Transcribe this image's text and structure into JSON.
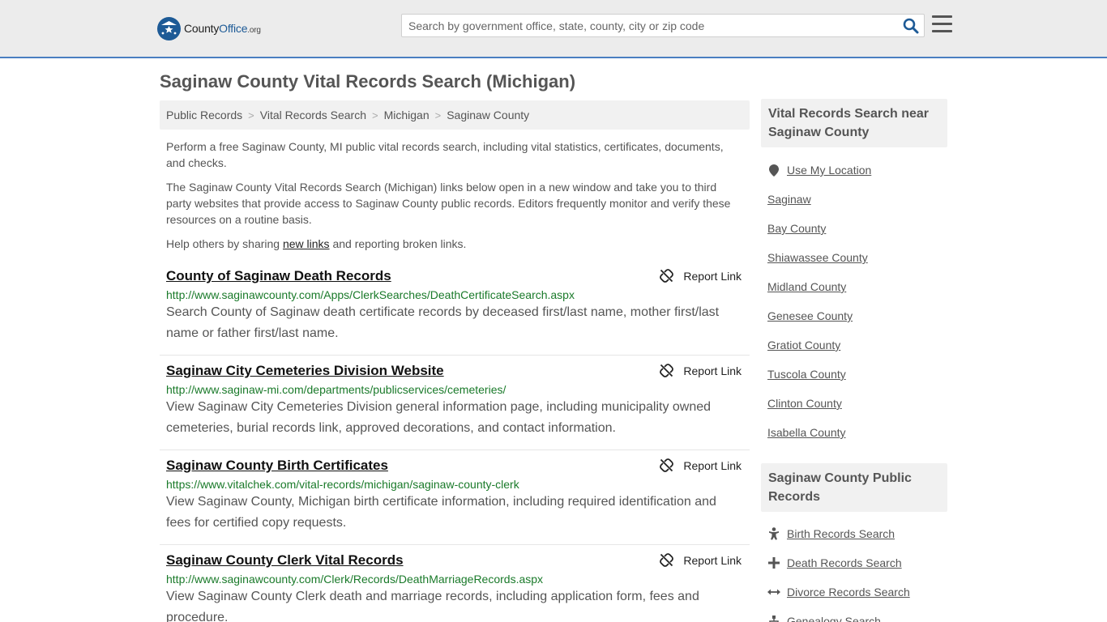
{
  "header": {
    "logo": {
      "county": "County",
      "office": "Office",
      "org": ".org"
    },
    "search_placeholder": "Search by government office, state, county, city or zip code"
  },
  "page_title": "Saginaw County Vital Records Search (Michigan)",
  "breadcrumb": [
    "Public Records",
    "Vital Records Search",
    "Michigan",
    "Saginaw County"
  ],
  "intro": {
    "p1": "Perform a free Saginaw County, MI public vital records search, including vital statistics, certificates, documents, and checks.",
    "p2": "The Saginaw County Vital Records Search (Michigan) links below open in a new window and take you to third party websites that provide access to Saginaw County public records. Editors frequently monitor and verify these resources on a routine basis.",
    "p3_before": "Help others by sharing ",
    "p3_link": "new links",
    "p3_after": " and reporting broken links."
  },
  "report_label": "Report Link",
  "results": [
    {
      "title": "County of Saginaw Death Records",
      "url": "http://www.saginawcounty.com/Apps/ClerkSearches/DeathCertificateSearch.aspx",
      "desc": "Search County of Saginaw death certificate records by deceased first/last name, mother first/last name or father first/last name."
    },
    {
      "title": "Saginaw City Cemeteries Division Website",
      "url": "http://www.saginaw-mi.com/departments/publicservices/cemeteries/",
      "desc": "View Saginaw City Cemeteries Division general information page, including municipality owned cemeteries, burial records link, approved decorations, and contact information."
    },
    {
      "title": "Saginaw County Birth Certificates",
      "url": "https://www.vitalchek.com/vital-records/michigan/saginaw-county-clerk",
      "desc": "View Saginaw County, Michigan birth certificate information, including required identification and fees for certified copy requests."
    },
    {
      "title": "Saginaw County Clerk Vital Records",
      "url": "http://www.saginawcounty.com/Clerk/Records/DeathMarriageRecords.aspx",
      "desc": "View Saginaw County Clerk death and marriage records, including application form, fees and procedure."
    }
  ],
  "sidebar": {
    "near_title": "Vital Records Search near Saginaw County",
    "use_location": "Use My Location",
    "near_items": [
      "Saginaw",
      "Bay County",
      "Shiawassee County",
      "Midland County",
      "Genesee County",
      "Gratiot County",
      "Tuscola County",
      "Clinton County",
      "Isabella County"
    ],
    "public_title": "Saginaw County Public Records",
    "public_items": [
      {
        "label": "Birth Records Search",
        "icon": "baby-icon"
      },
      {
        "label": "Death Records Search",
        "icon": "cross-icon"
      },
      {
        "label": "Divorce Records Search",
        "icon": "arrows-icon"
      },
      {
        "label": "Genealogy Search",
        "icon": "tree-icon"
      }
    ]
  },
  "colors": {
    "accent": "#1d5a96",
    "url_green": "#1a7a2a",
    "header_bg": "#ececec"
  }
}
